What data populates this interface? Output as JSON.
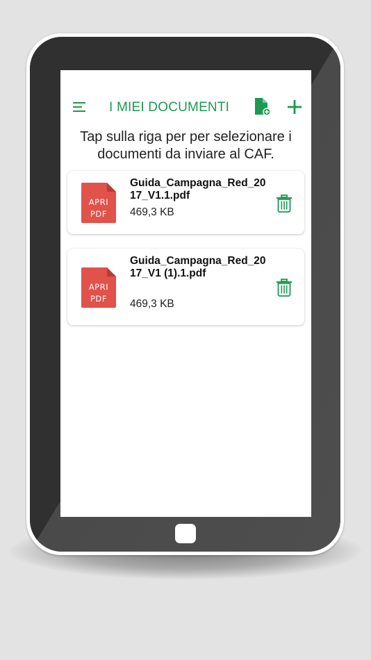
{
  "colors": {
    "accent": "#1a9a52",
    "pdf_red": "#e0524a",
    "bezel": "#3a3a3a",
    "background": "#e3e3e3"
  },
  "header": {
    "title": "I MIEI DOCUMENTI",
    "menu_icon": "menu-icon",
    "document_icon": "add-document-icon",
    "add_icon": "plus-icon"
  },
  "instructions": "Tap sulla riga per per selezionare i documenti da inviare al CAF.",
  "documents": [
    {
      "name": "Guida_Campagna_Red_2017_V1.1.pdf",
      "size": "469,3 KB",
      "thumb_line1": "APRI",
      "thumb_line2": "PDF",
      "delete_icon": "trash-icon"
    },
    {
      "name": "Guida_Campagna_Red_2017_V1 (1).1.pdf",
      "size": "469,3 KB",
      "thumb_line1": "APRI",
      "thumb_line2": "PDF",
      "delete_icon": "trash-icon"
    }
  ]
}
